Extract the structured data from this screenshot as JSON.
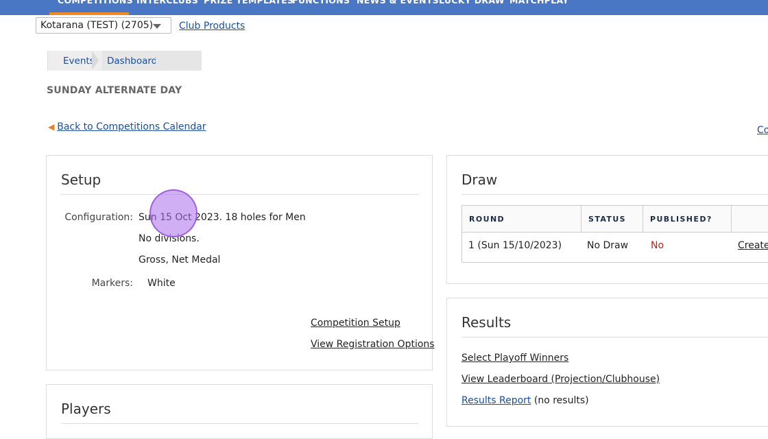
{
  "topnav": {
    "items": [
      "COMPETITIONS",
      "INTERCLUBS",
      "PRIZE TEMPLATES",
      "FUNCTIONS",
      "NEWS & EVENTS",
      "LUCKY DRAW",
      "MATCHPLAY"
    ],
    "active": "COMPETITIONS",
    "bg_color": "#4a77c4",
    "active_color": "#f08a24"
  },
  "club_select": {
    "value": "Kotarana (TEST) (2705)"
  },
  "club_products_link": "Club Products",
  "breadcrumb": [
    "Events",
    "Dashboard"
  ],
  "page_title": "SUNDAY ALTERNATE DAY",
  "back_link": "Back to Competitions Calendar",
  "right_cut_link": "Co",
  "setup": {
    "title": "Setup",
    "configuration_label": "Configuration:",
    "configuration_lines": [
      "Sun 15 Oct 2023. 18 holes for Men",
      "No divisions.",
      "Gross, Net Medal"
    ],
    "markers_label": "Markers:",
    "markers_value": "White",
    "links": [
      "Competition Setup",
      "View Registration Options"
    ]
  },
  "players": {
    "title": "Players"
  },
  "draw": {
    "title": "Draw",
    "columns": [
      "ROUND",
      "STATUS",
      "PUBLISHED?",
      ""
    ],
    "row": {
      "round": "1 (Sun 15/10/2023)",
      "status": "No Draw",
      "published": "No",
      "action": "Create"
    }
  },
  "results": {
    "title": "Results",
    "links": [
      "Select Playoff Winners",
      "View Leaderboard (Projection/Clubhouse)",
      "Results Report"
    ],
    "results_report_note": "(no results)"
  }
}
